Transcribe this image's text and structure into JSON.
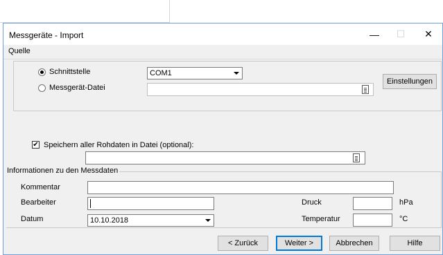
{
  "dialog": {
    "title": "Messgeräte - Import",
    "minimize_glyph": "—",
    "maximize_glyph": "☐",
    "close_glyph": "✕"
  },
  "menu": {
    "items": [
      {
        "label": "Quelle"
      }
    ]
  },
  "source": {
    "radio_interface_label": "Schnittstelle",
    "radio_file_label": "Messgerät-Datei",
    "interface_value": "COM1",
    "file_value": "",
    "settings_button": "Einstellungen",
    "selected": "Schnittstelle"
  },
  "raw": {
    "checkbox_label": "Speichern aller Rohdaten in Datei (optional):",
    "checked": true,
    "check_glyph": "✔",
    "path_value": ""
  },
  "info": {
    "group_title": "Informationen zu den Messdaten",
    "comment_label": "Kommentar",
    "comment_value": "",
    "editor_label": "Bearbeiter",
    "editor_value": "",
    "date_label": "Datum",
    "date_value": "10.10.2018",
    "pressure_label": "Druck",
    "pressure_value": "",
    "pressure_unit": "hPa",
    "temperature_label": "Temperatur",
    "temperature_value": "",
    "temperature_unit": "°C"
  },
  "buttons": {
    "back": "< Zurück",
    "next": "Weiter >",
    "cancel": "Abbrechen",
    "help": "Hilfe"
  },
  "icons": {
    "file_browse": "file-browse-icon",
    "dropdown": "chevron-down-icon"
  },
  "colors": {
    "window_border": "#6f9fd6",
    "dialog_bg": "#f0f0f0",
    "default_button_border": "#0078d7"
  }
}
